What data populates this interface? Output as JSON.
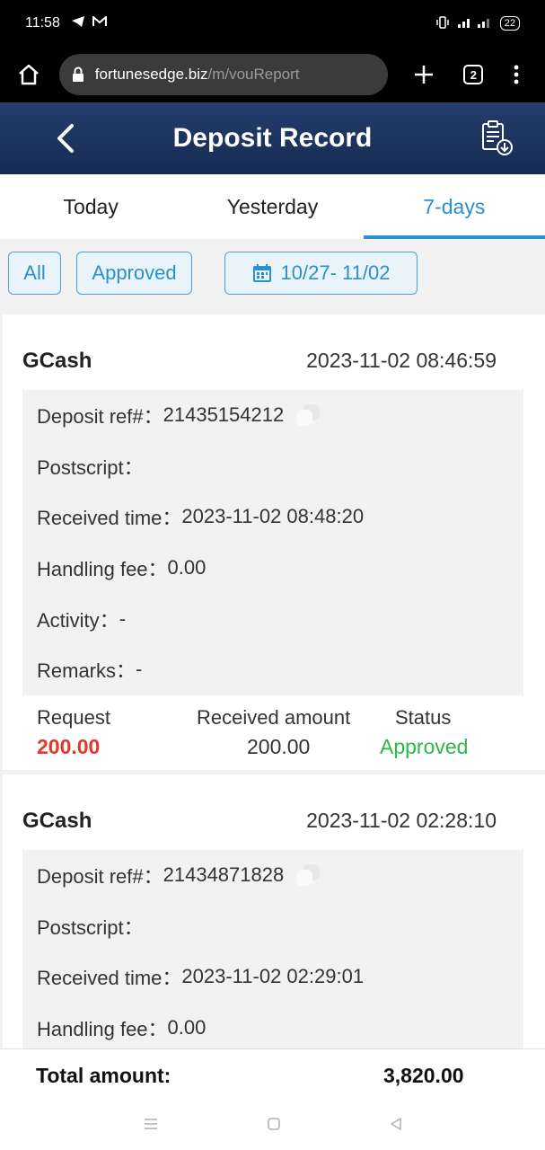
{
  "status_bar": {
    "time": "11:58",
    "battery": "22"
  },
  "browser": {
    "url_host": "fortunesedge.biz",
    "url_path": "/m/vouReport",
    "tab_count": "2"
  },
  "header": {
    "title": "Deposit Record"
  },
  "tabs": [
    {
      "label": "Today"
    },
    {
      "label": "Yesterday"
    },
    {
      "label": "7-days"
    }
  ],
  "filters": {
    "all": "All",
    "approved": "Approved",
    "date_range": "10/27- 11/02"
  },
  "records": [
    {
      "method": "GCash",
      "datetime": "2023-11-02 08:46:59",
      "deposit_ref_label": "Deposit ref#：",
      "deposit_ref": "21435154212",
      "postscript_label": "Postscript：",
      "received_time_label": "Received time：",
      "received_time": "2023-11-02 08:48:20",
      "handling_fee_label": "Handling fee：",
      "handling_fee": "0.00",
      "activity_label": "Activity：",
      "activity": "-",
      "remarks_label": "Remarks：",
      "remarks": "-",
      "request_header": "Request",
      "request": "200.00",
      "received_header": "Received amount",
      "received": "200.00",
      "status_header": "Status",
      "status": "Approved"
    },
    {
      "method": "GCash",
      "datetime": "2023-11-02 02:28:10",
      "deposit_ref_label": "Deposit ref#：",
      "deposit_ref": "21434871828",
      "postscript_label": "Postscript：",
      "received_time_label": "Received time：",
      "received_time": "2023-11-02 02:29:01",
      "handling_fee_label": "Handling fee：",
      "handling_fee": "0.00"
    }
  ],
  "total": {
    "label": "Total amount:",
    "amount": "3,820.00"
  },
  "colors": {
    "accent": "#2b8fd0",
    "header": "#1c3360",
    "request": "#e0392b",
    "approved": "#2bb84a"
  }
}
